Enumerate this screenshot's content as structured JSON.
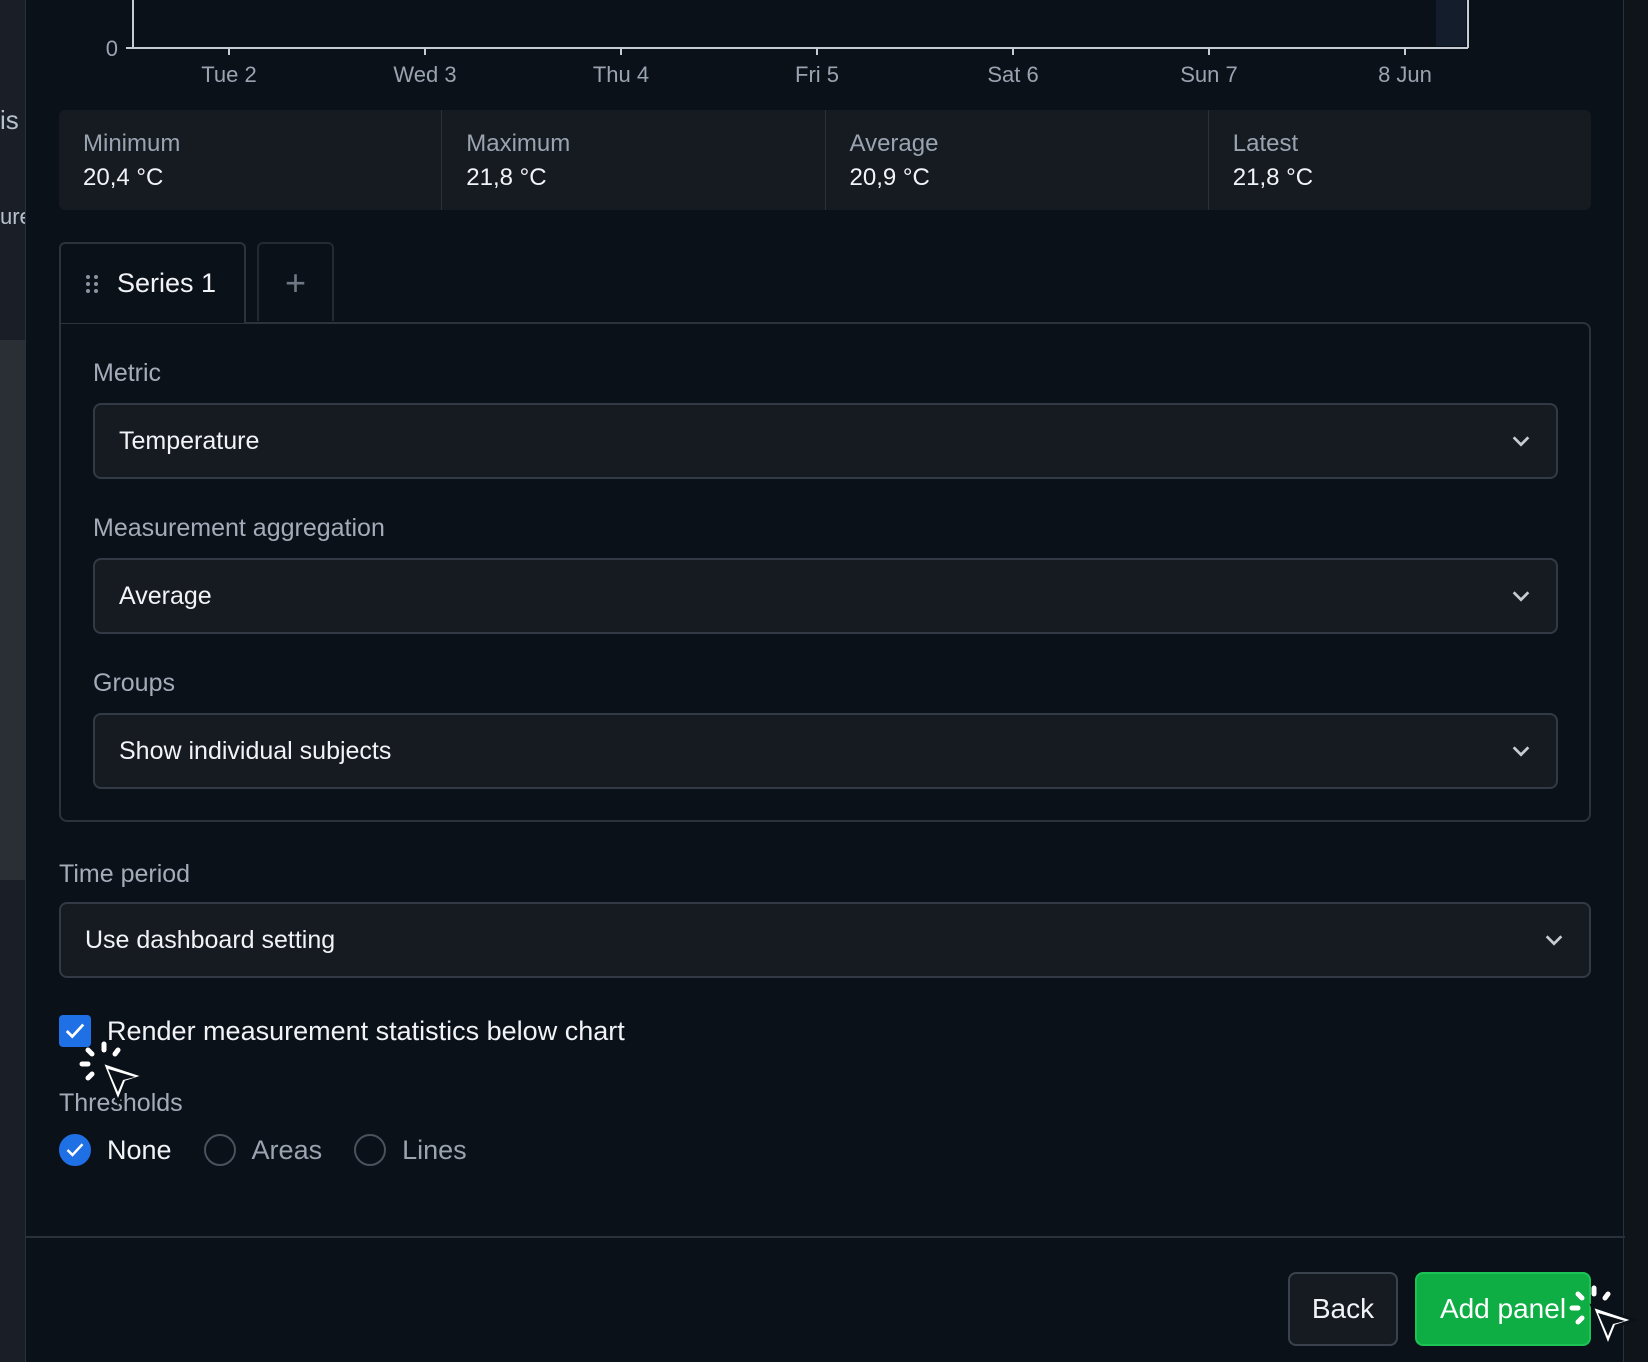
{
  "backdrop": {
    "fragment_1": "is",
    "fragment_2": "ure"
  },
  "chart_data": {
    "type": "line",
    "x_ticks": [
      "Tue 2",
      "Wed 3",
      "Thu 4",
      "Fri 5",
      "Sat 6",
      "Sun 7",
      "8 Jun"
    ],
    "y_ticks": [
      "0"
    ]
  },
  "stats": [
    {
      "label": "Minimum",
      "value": "20,4 °C"
    },
    {
      "label": "Maximum",
      "value": "21,8 °C"
    },
    {
      "label": "Average",
      "value": "20,9 °C"
    },
    {
      "label": "Latest",
      "value": "21,8 °C"
    }
  ],
  "tabs": {
    "series_label": "Series 1",
    "add_symbol": "+"
  },
  "series": {
    "metric_label": "Metric",
    "metric_value": "Temperature",
    "aggregation_label": "Measurement aggregation",
    "aggregation_value": "Average",
    "groups_label": "Groups",
    "groups_value": "Show individual subjects"
  },
  "time_period": {
    "label": "Time period",
    "value": "Use dashboard setting"
  },
  "statistics_checkbox": {
    "label": "Render measurement statistics below chart",
    "checked": true
  },
  "thresholds": {
    "label": "Thresholds",
    "options": [
      "None",
      "Areas",
      "Lines"
    ],
    "selected": "None"
  },
  "footer": {
    "back_label": "Back",
    "add_label": "Add panel"
  },
  "colors": {
    "accent": "#1f6fe5",
    "primary_button": "#0fae44"
  }
}
